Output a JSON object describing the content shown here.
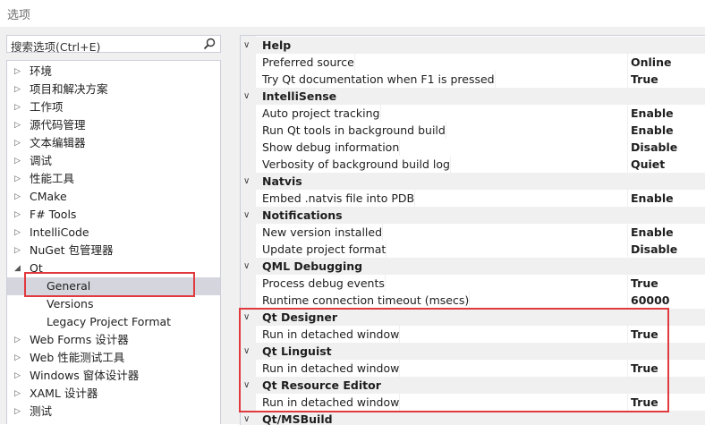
{
  "window": {
    "title": "选项"
  },
  "search": {
    "placeholder": "搜索选项(Ctrl+E)"
  },
  "tree": {
    "items": [
      {
        "label": "环境",
        "expanded": false
      },
      {
        "label": "项目和解决方案",
        "expanded": false
      },
      {
        "label": "工作项",
        "expanded": false
      },
      {
        "label": "源代码管理",
        "expanded": false
      },
      {
        "label": "文本编辑器",
        "expanded": false
      },
      {
        "label": "调试",
        "expanded": false
      },
      {
        "label": "性能工具",
        "expanded": false
      },
      {
        "label": "CMake",
        "expanded": false
      },
      {
        "label": "F# Tools",
        "expanded": false
      },
      {
        "label": "IntelliCode",
        "expanded": false
      },
      {
        "label": "NuGet 包管理器",
        "expanded": false
      },
      {
        "label": "Qt",
        "expanded": true,
        "children": [
          {
            "label": "General",
            "selected": true
          },
          {
            "label": "Versions"
          },
          {
            "label": "Legacy Project Format"
          }
        ]
      },
      {
        "label": "Web Forms 设计器",
        "expanded": false
      },
      {
        "label": "Web 性能测试工具",
        "expanded": false
      },
      {
        "label": "Windows 窗体设计器",
        "expanded": false
      },
      {
        "label": "XAML 设计器",
        "expanded": false
      },
      {
        "label": "测试",
        "expanded": false
      }
    ]
  },
  "properties": {
    "categories": [
      {
        "name": "Help",
        "items": [
          {
            "name": "Preferred source",
            "value": "Online"
          },
          {
            "name": "Try Qt documentation when F1 is pressed",
            "value": "True"
          }
        ]
      },
      {
        "name": "IntelliSense",
        "items": [
          {
            "name": "Auto project tracking",
            "value": "Enable"
          },
          {
            "name": "Run Qt tools in background build",
            "value": "Enable"
          },
          {
            "name": "Show debug information",
            "value": "Disable"
          },
          {
            "name": "Verbosity of background build log",
            "value": "Quiet"
          }
        ]
      },
      {
        "name": "Natvis",
        "items": [
          {
            "name": "Embed .natvis file into PDB",
            "value": "Enable"
          }
        ]
      },
      {
        "name": "Notifications",
        "items": [
          {
            "name": "New version installed",
            "value": "Enable"
          },
          {
            "name": "Update project format",
            "value": "Disable"
          }
        ]
      },
      {
        "name": "QML Debugging",
        "items": [
          {
            "name": "Process debug events",
            "value": "True"
          },
          {
            "name": "Runtime connection timeout (msecs)",
            "value": "60000"
          }
        ]
      },
      {
        "name": "Qt Designer",
        "items": [
          {
            "name": "Run in detached window",
            "value": "True"
          }
        ]
      },
      {
        "name": "Qt Linguist",
        "items": [
          {
            "name": "Run in detached window",
            "value": "True"
          }
        ]
      },
      {
        "name": "Qt Resource Editor",
        "items": [
          {
            "name": "Run in detached window",
            "value": "True"
          }
        ]
      },
      {
        "name": "Qt/MSBuild",
        "items": []
      }
    ]
  },
  "colors": {
    "highlight": "#e0393e",
    "selection": "#d5d5de",
    "pane_bg": "#f0f0f0"
  }
}
